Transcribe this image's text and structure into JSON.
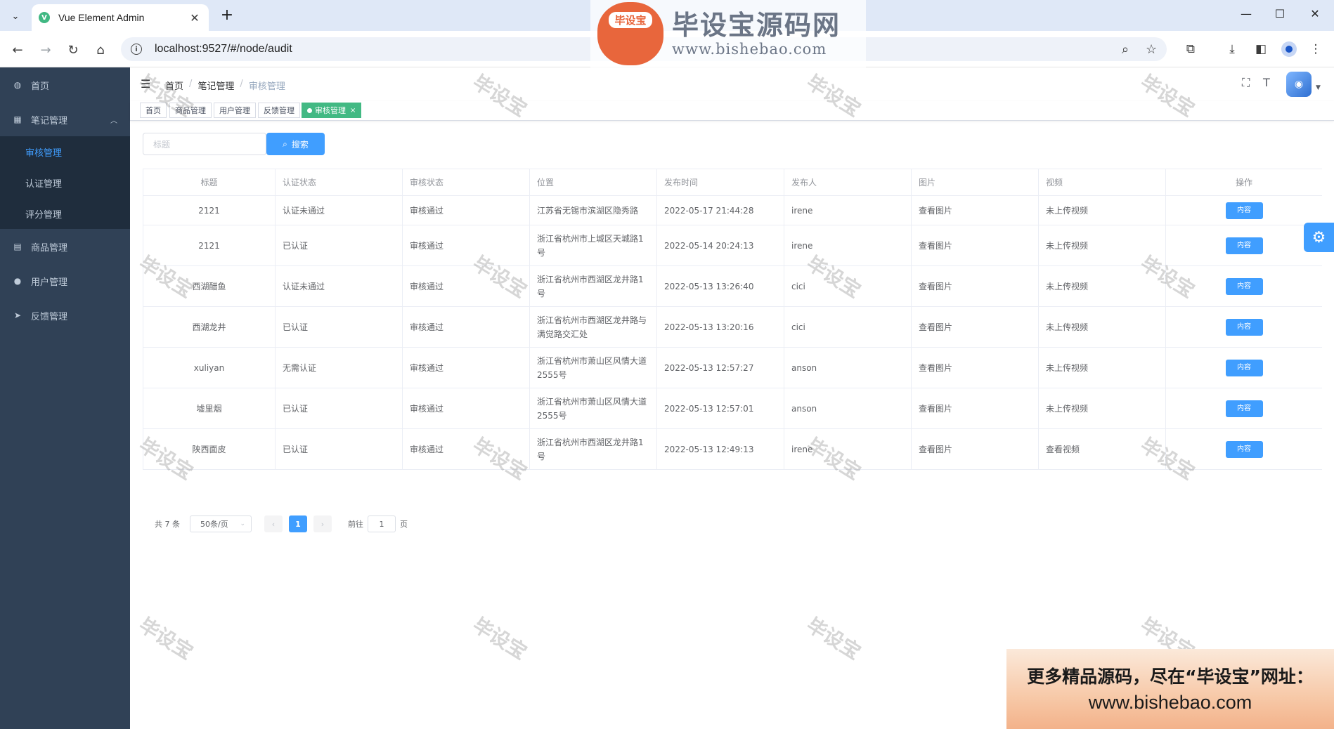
{
  "browser": {
    "tab_title": "Vue Element Admin",
    "favicon_letter": "V",
    "url": "localhost:9527/#/node/audit"
  },
  "sidebar": {
    "items": [
      {
        "label": "首页",
        "icon": "dashboard-icon"
      },
      {
        "label": "笔记管理",
        "icon": "table-icon"
      },
      {
        "label": "商品管理",
        "icon": "document-icon"
      },
      {
        "label": "用户管理",
        "icon": "user-icon"
      },
      {
        "label": "反馈管理",
        "icon": "send-icon"
      }
    ],
    "sub_items": [
      {
        "label": "审核管理"
      },
      {
        "label": "认证管理"
      },
      {
        "label": "评分管理"
      }
    ]
  },
  "breadcrumb": [
    "首页",
    "笔记管理",
    "审核管理"
  ],
  "tags": [
    "首页",
    "商品管理",
    "用户管理",
    "反馈管理",
    "审核管理"
  ],
  "filter": {
    "placeholder": "标题",
    "search_label": "搜索"
  },
  "table": {
    "headers": [
      "标题",
      "认证状态",
      "审核状态",
      "位置",
      "发布时间",
      "发布人",
      "图片",
      "视频",
      "操作"
    ],
    "action_label": "内容",
    "rows": [
      {
        "title": "2121",
        "cert": "认证未通过",
        "audit": "审核通过",
        "location": "江苏省无锡市滨湖区隐秀路",
        "time": "2022-05-17 21:44:28",
        "author": "irene",
        "image": "查看图片",
        "video": "未上传视频"
      },
      {
        "title": "2121",
        "cert": "已认证",
        "audit": "审核通过",
        "location": "浙江省杭州市上城区天城路1号",
        "time": "2022-05-14 20:24:13",
        "author": "irene",
        "image": "查看图片",
        "video": "未上传视频"
      },
      {
        "title": "西湖醋鱼",
        "cert": "认证未通过",
        "audit": "审核通过",
        "location": "浙江省杭州市西湖区龙井路1号",
        "time": "2022-05-13 13:26:40",
        "author": "cici",
        "image": "查看图片",
        "video": "未上传视频"
      },
      {
        "title": "西湖龙井",
        "cert": "已认证",
        "audit": "审核通过",
        "location": "浙江省杭州市西湖区龙井路与满觉路交汇处",
        "time": "2022-05-13 13:20:16",
        "author": "cici",
        "image": "查看图片",
        "video": "未上传视频"
      },
      {
        "title": "xuliyan",
        "cert": "无需认证",
        "audit": "审核通过",
        "location": "浙江省杭州市萧山区风情大道2555号",
        "time": "2022-05-13 12:57:27",
        "author": "anson",
        "image": "查看图片",
        "video": "未上传视频"
      },
      {
        "title": "墟里烟",
        "cert": "已认证",
        "audit": "审核通过",
        "location": "浙江省杭州市萧山区风情大道2555号",
        "time": "2022-05-13 12:57:01",
        "author": "anson",
        "image": "查看图片",
        "video": "未上传视频"
      },
      {
        "title": "陕西面皮",
        "cert": "已认证",
        "audit": "审核通过",
        "location": "浙江省杭州市西湖区龙井路1号",
        "time": "2022-05-13 12:49:13",
        "author": "irene",
        "image": "查看图片",
        "video": "查看视频"
      }
    ]
  },
  "pagination": {
    "total": "共 7 条",
    "page_size": "50条/页",
    "current": "1",
    "goto_label": "前往",
    "goto_value": "1",
    "page_suffix": "页"
  },
  "watermark": {
    "logo_badge": "毕设宝",
    "brand_cn": "毕设宝源码网",
    "brand_url": "www.bishebao.com",
    "repeat_text": "毕设宝",
    "promo_line1": "更多精品源码，尽在“毕设宝”网址：",
    "promo_line2": "www.bishebao.com"
  },
  "colors": {
    "sidebar_bg": "#304156",
    "submenu_bg": "#1f2d3d",
    "primary": "#409eff",
    "tag_active": "#42b983"
  }
}
